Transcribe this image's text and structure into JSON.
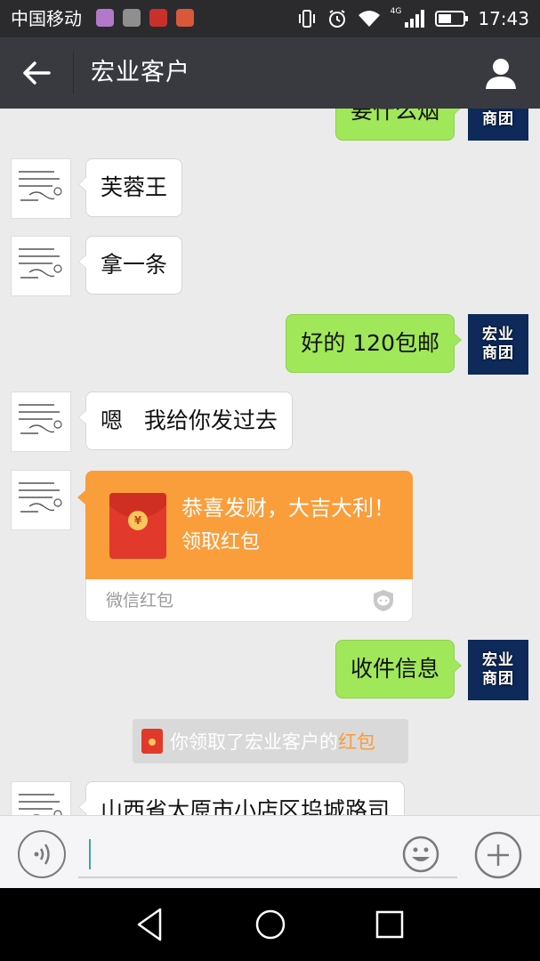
{
  "status_bar": {
    "carrier": "中国移动",
    "network": "4G",
    "time": "17:43"
  },
  "header": {
    "title": "宏业客户"
  },
  "contact_avatar_brand": [
    "宏业",
    "商团"
  ],
  "messages": [
    {
      "side": "right",
      "text": "要什么烟"
    },
    {
      "side": "left",
      "text": "芙蓉王"
    },
    {
      "side": "left",
      "text": "拿一条"
    },
    {
      "side": "right",
      "text": "好的 120包邮"
    },
    {
      "side": "left",
      "text": "嗯   我给你发过去"
    },
    {
      "side": "right",
      "text": "收件信息"
    },
    {
      "side": "left",
      "text": "山西省太原市小店区坞城路司"
    }
  ],
  "red_packet": {
    "greeting": "恭喜发财，大吉大利！",
    "action": "领取红包",
    "brand": "微信红包"
  },
  "notice": {
    "prefix": "你领取了宏业客户的",
    "link": "红包"
  },
  "colors": {
    "status_bar": "#2b2b2d",
    "title_bar": "#393a3f",
    "chat_bg": "#ebebeb",
    "bubble_right": "#a0e75a",
    "red_packet": "#fa9d3b",
    "notice_link": "#fa9d3b"
  }
}
